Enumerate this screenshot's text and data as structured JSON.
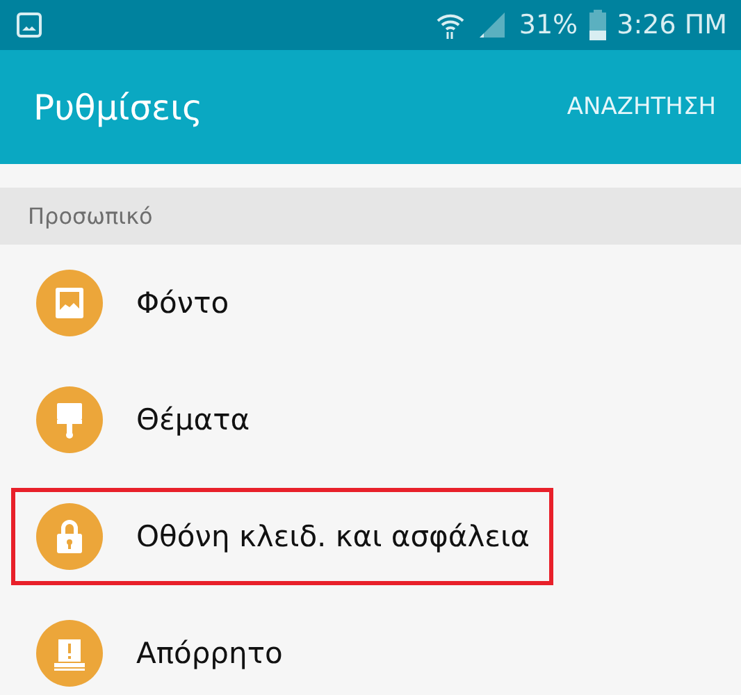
{
  "status_bar": {
    "battery": "31%",
    "time": "3:26 ΠΜ"
  },
  "app_bar": {
    "title": "Ρυθμίσεις",
    "action": "ΑΝΑΖΗΤΗΣΗ"
  },
  "section": {
    "header": "Προσωπικό"
  },
  "items": [
    {
      "kind": "wallpaper",
      "label": "Φόντο",
      "highlighted": false
    },
    {
      "kind": "themes",
      "label": "Θέματα",
      "highlighted": false
    },
    {
      "kind": "lock",
      "label": "Οθόνη κλειδ. και ασφάλεια",
      "highlighted": true
    },
    {
      "kind": "privacy",
      "label": "Απόρρητο",
      "highlighted": false
    }
  ]
}
